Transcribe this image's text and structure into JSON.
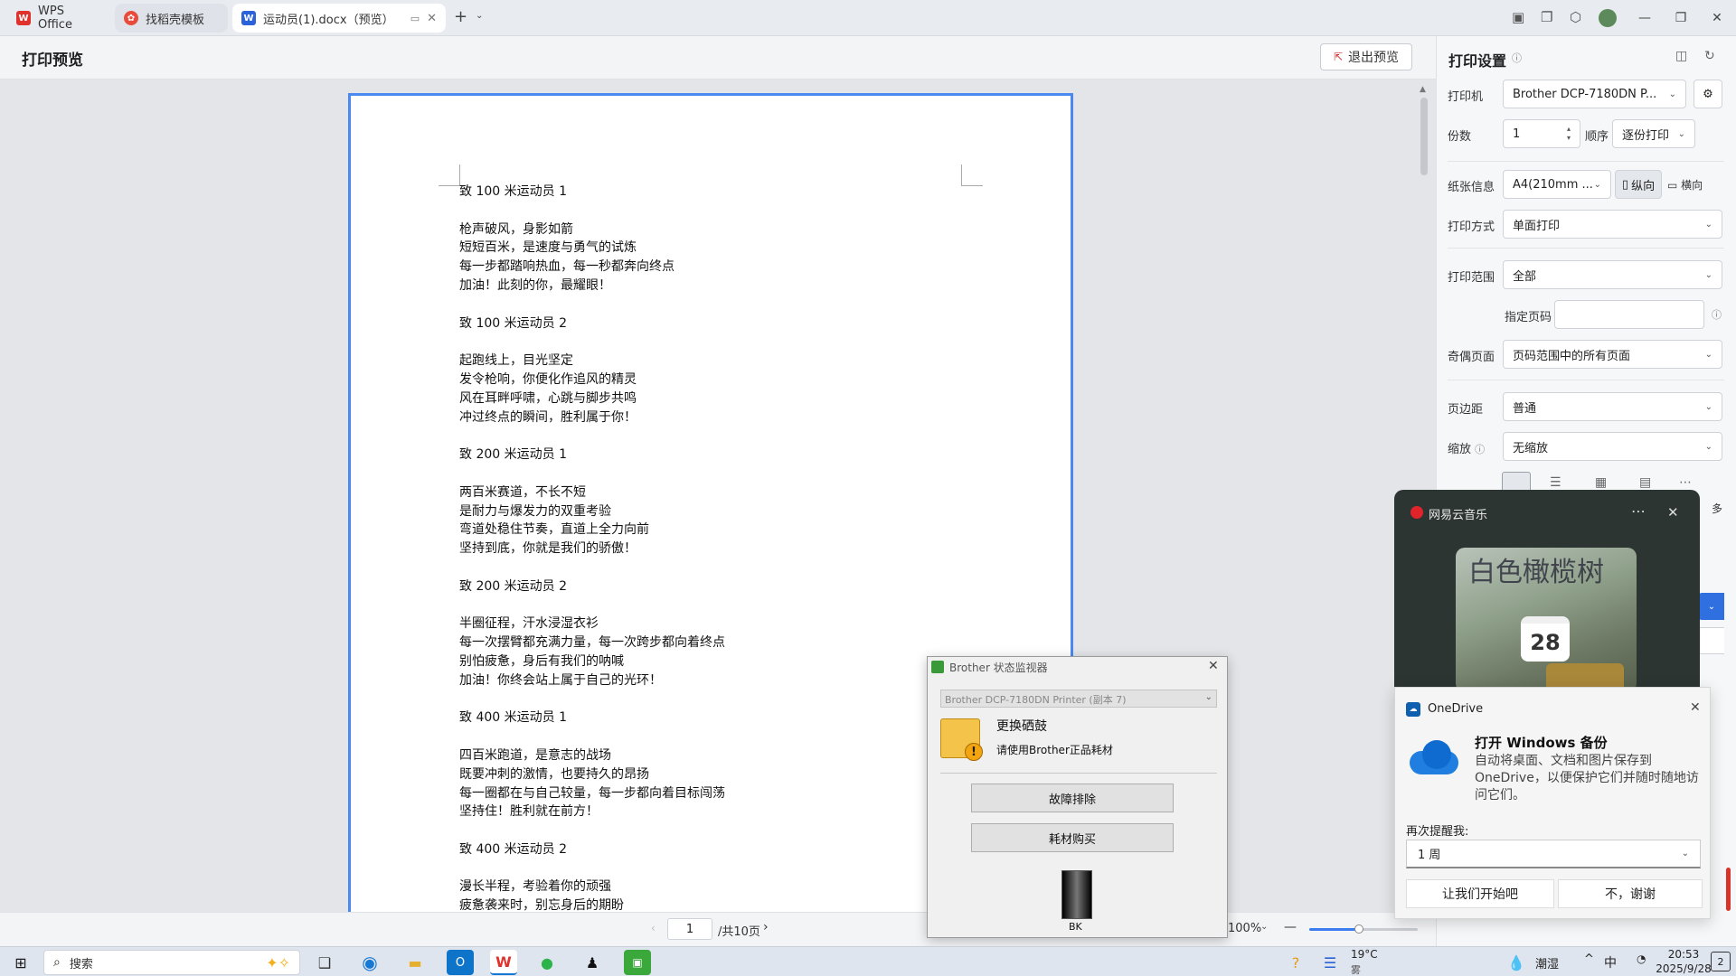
{
  "tabs": [
    {
      "label": "WPS Office",
      "icon": "wps-logo-icon",
      "color": "#e0312b"
    },
    {
      "label": "找稻壳模板",
      "icon": "docer-icon",
      "color": "#e84a3b"
    },
    {
      "label": "运动员(1).docx（预览）",
      "icon": "word-doc-icon",
      "color": "#2b62d9"
    }
  ],
  "preview": {
    "title": "打印预览",
    "exit_label": "退出预览",
    "doc_lines": [
      "致 100 米运动员 1",
      "",
      "枪声破风，身影如箭",
      "短短百米，是速度与勇气的试炼",
      "每一步都踏响热血，每一秒都奔向终点",
      "加油！此刻的你，最耀眼！",
      "",
      "致 100 米运动员 2",
      "",
      "起跑线上，目光坚定",
      "发令枪响，你便化作追风的精灵",
      "风在耳畔呼啸，心跳与脚步共鸣",
      "冲过终点的瞬间，胜利属于你！",
      "",
      "致 200 米运动员 1",
      "",
      "两百米赛道，不长不短",
      "是耐力与爆发力的双重考验",
      "弯道处稳住节奏，直道上全力向前",
      "坚持到底，你就是我们的骄傲！",
      "",
      "致 200 米运动员 2",
      "",
      "半圈征程，汗水浸湿衣衫",
      "每一次摆臂都充满力量，每一次跨步都向着终点",
      "别怕疲惫，身后有我们的呐喊",
      "加油！你终会站上属于自己的光环！",
      "",
      "致 400 米运动员 1",
      "",
      "四百米跑道，是意志的战场",
      "既要冲刺的激情，也要持久的昂扬",
      "每一圈都在与自己较量，每一步都向着目标闯荡",
      "坚持住！胜利就在前方！",
      "",
      "致 400 米运动员 2",
      "",
      "漫长半程，考验着你的顽强",
      "疲惫袭来时，别忘身后的期盼"
    ],
    "page_current": "1",
    "page_total": "/共10页",
    "zoom": "100%"
  },
  "settings": {
    "title": "打印设置",
    "printer_label": "打印机",
    "printer_value": "Brother DCP-7180DN P...",
    "copies_label": "份数",
    "copies_value": "1",
    "order_label": "顺序",
    "order_value": "逐份打印",
    "paper_label": "纸张信息",
    "paper_value": "A4(210mm ...",
    "portrait_label": "纵向",
    "landscape_label": "横向",
    "mode_label": "打印方式",
    "mode_value": "单面打印",
    "range_label": "打印范围",
    "range_value": "全部",
    "pages_label": "指定页码",
    "pages_value": "",
    "oddeven_label": "奇偶页面",
    "oddeven_value": "页码范围中的所有页面",
    "margin_label": "页边距",
    "margin_value": "普通",
    "scale_label": "缩放",
    "scale_value": "无缩放",
    "more_label": "多"
  },
  "music": {
    "app_name": "网易云音乐",
    "album_text": "白色橄榄树",
    "date_badge": "28"
  },
  "onedrive": {
    "app_name": "OneDrive",
    "title": "打开 Windows 备份",
    "body": "自动将桌面、文档和图片保存到 OneDrive，以便保护它们并随时随地访问它们。",
    "remind_label": "再次提醒我:",
    "remind_value": "1 周",
    "start_label": "让我们开始吧",
    "no_label": "不，谢谢"
  },
  "brother": {
    "title": "Brother 状态监视器",
    "printer": "Brother DCP-7180DN Printer (副本 7)",
    "status": "更换硒鼓",
    "sub": "请使用Brother正品耗材",
    "troubleshoot_label": "故障排除",
    "buy_label": "耗材购买",
    "toner_label": "BK"
  },
  "taskbar": {
    "search_placeholder": "搜索",
    "weather_temp": "19°C",
    "weather_desc": "雾",
    "humidity_label": "潮湿",
    "ime": "中",
    "time": "20:53",
    "date": "2025/9/28",
    "notif_count": "2"
  }
}
